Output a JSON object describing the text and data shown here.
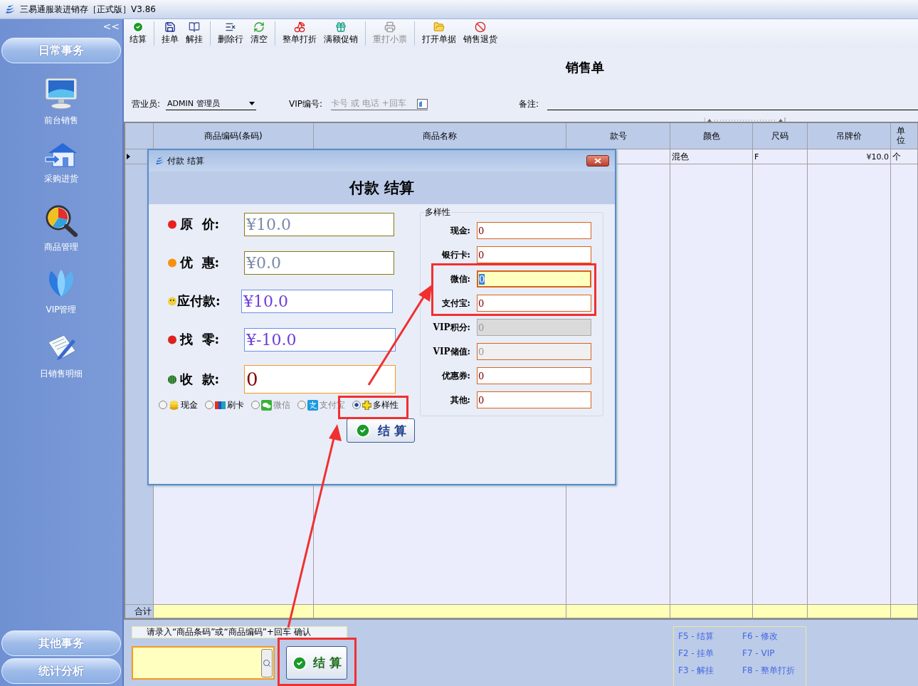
{
  "window": {
    "title": "三易通服装进销存［正式版］V3.86"
  },
  "sidebar": {
    "collapse": "<<",
    "top_section": "日常事务",
    "items": [
      {
        "label": "前台销售",
        "kind": "monitor"
      },
      {
        "label": "采购进货",
        "kind": "house"
      },
      {
        "label": "商品管理",
        "kind": "magnifier"
      },
      {
        "label": "VIP管理",
        "kind": "petals"
      },
      {
        "label": "日销售明细",
        "kind": "document"
      }
    ],
    "bottom_sections": [
      "其他事务",
      "统计分析"
    ]
  },
  "toolbar": {
    "groups": [
      [
        {
          "label": "结算",
          "kind": "check",
          "disabled": false
        }
      ],
      [
        {
          "label": "挂单",
          "kind": "save",
          "disabled": false
        },
        {
          "label": "解挂",
          "kind": "book",
          "disabled": false
        }
      ],
      [
        {
          "label": "删除行",
          "kind": "delete",
          "disabled": false
        },
        {
          "label": "清空",
          "kind": "refresh",
          "disabled": false
        }
      ],
      [
        {
          "label": "整单打折",
          "kind": "fruit",
          "disabled": false
        },
        {
          "label": "满额促销",
          "kind": "gift",
          "disabled": false
        }
      ],
      [
        {
          "label": "重打小票",
          "kind": "printer",
          "disabled": true
        }
      ],
      [
        {
          "label": "打开单据",
          "kind": "folder",
          "disabled": false
        },
        {
          "label": "销售退货",
          "kind": "ban",
          "disabled": false
        }
      ]
    ]
  },
  "form": {
    "title": "销售单",
    "salesperson_label": "营业员:",
    "salesperson": "ADMIN 管理员",
    "vip_label": "VIP编号:",
    "vip_placeholder": "卡号 或 电话 +回车",
    "remark_label": "备注:"
  },
  "table": {
    "columns": [
      "商品编码(条码)",
      "商品名称",
      "款号",
      "颜色",
      "尺码",
      "吊牌价",
      "单位"
    ],
    "rows": [
      {
        "current": true,
        "color_name": "混色",
        "size": "F",
        "tag_price": "¥10.0",
        "unit": "个"
      }
    ],
    "total_label": "合计"
  },
  "dialog": {
    "title": "付款 结算",
    "heading": "付款 结算",
    "fields": [
      {
        "label": "原  价:",
        "value": "¥10.0",
        "kind": "muted"
      },
      {
        "label": "优  惠:",
        "value": "¥0.0",
        "kind": "muted"
      },
      {
        "label": "应付款:",
        "value": "¥10.0",
        "kind": "accent"
      },
      {
        "label": "找  零:",
        "value": "¥-10.0",
        "kind": "accent"
      },
      {
        "label": "收  款:",
        "value": "0",
        "kind": "input"
      }
    ],
    "payment_methods": [
      {
        "label": "现金",
        "kind": "coins",
        "selected": false,
        "disabled": false
      },
      {
        "label": "刷卡",
        "kind": "card",
        "selected": false,
        "disabled": false
      },
      {
        "label": "微信",
        "kind": "chat",
        "selected": false,
        "disabled": true
      },
      {
        "label": "支付宝",
        "kind": "pay",
        "selected": false,
        "disabled": true
      },
      {
        "label": "多样性",
        "kind": "plus",
        "selected": true,
        "disabled": false
      }
    ],
    "multi": {
      "legend": "多样性",
      "fields": [
        {
          "label": "现金:",
          "value": "0",
          "kind": "normal"
        },
        {
          "label": "银行卡:",
          "value": "0",
          "kind": "normal"
        },
        {
          "label": "微信:",
          "value": "0",
          "kind": "focused"
        },
        {
          "label": "支付宝:",
          "value": "0",
          "kind": "normal"
        },
        {
          "label": "VIP积分:",
          "value": "0",
          "kind": "disabled"
        },
        {
          "label": "VIP储值:",
          "value": "0",
          "kind": "readonly"
        },
        {
          "label": "优惠券:",
          "value": "0",
          "kind": "normal"
        },
        {
          "label": "其他:",
          "value": "0",
          "kind": "normal"
        }
      ]
    },
    "button": "结 算"
  },
  "bottom": {
    "hint": "请录入“商品条码”或“商品编码”+回车 确认",
    "button": "结 算",
    "hotkeys": [
      "F5 - 结算",
      "F6 - 修改",
      "F2 - 挂单",
      "F7 - VIP",
      "F3 - 解挂",
      "F8 - 整单打折"
    ]
  }
}
